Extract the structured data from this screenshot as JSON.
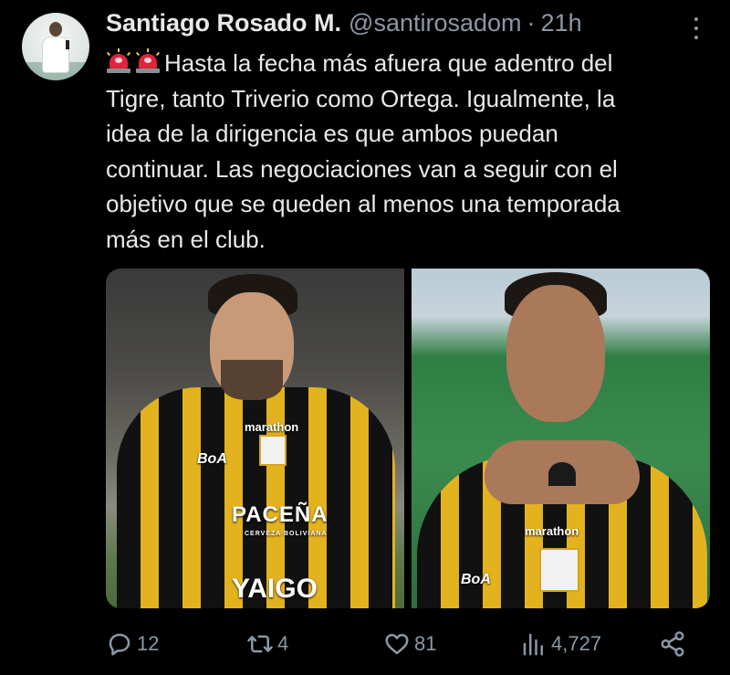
{
  "author": {
    "name": "Santiago Rosado M.",
    "handle": "@santirosadom",
    "separator": "·",
    "time": "21h"
  },
  "tweet": {
    "lines": [
      "Hasta la fecha más afuera que adentro del",
      "Tigre, tanto Triverio como Ortega. Igualmente, la",
      "idea de la dirigencia es que ambos puedan",
      "continuar. Las negociaciones van a seguir con el",
      "objetivo que se queden al menos una temporada",
      "más en el club."
    ],
    "leading_icons": [
      "police-siren-icon",
      "police-siren-icon"
    ]
  },
  "media": {
    "left": {
      "marathon": "marathon",
      "boa": "BoA",
      "pacena": "PACEÑA",
      "cerveza": "CERVEZA BOLIVIANA",
      "yaigo": "YAIGO"
    },
    "right": {
      "marathon": "marathon",
      "boa": "BoA"
    }
  },
  "actions": {
    "replies": "12",
    "retweets": "4",
    "likes": "81",
    "views": "4,727"
  },
  "colors": {
    "background": "#000000",
    "text_primary": "#e7e9ea",
    "text_secondary": "#8b98a5",
    "jersey_gold": "#e3b21f"
  }
}
